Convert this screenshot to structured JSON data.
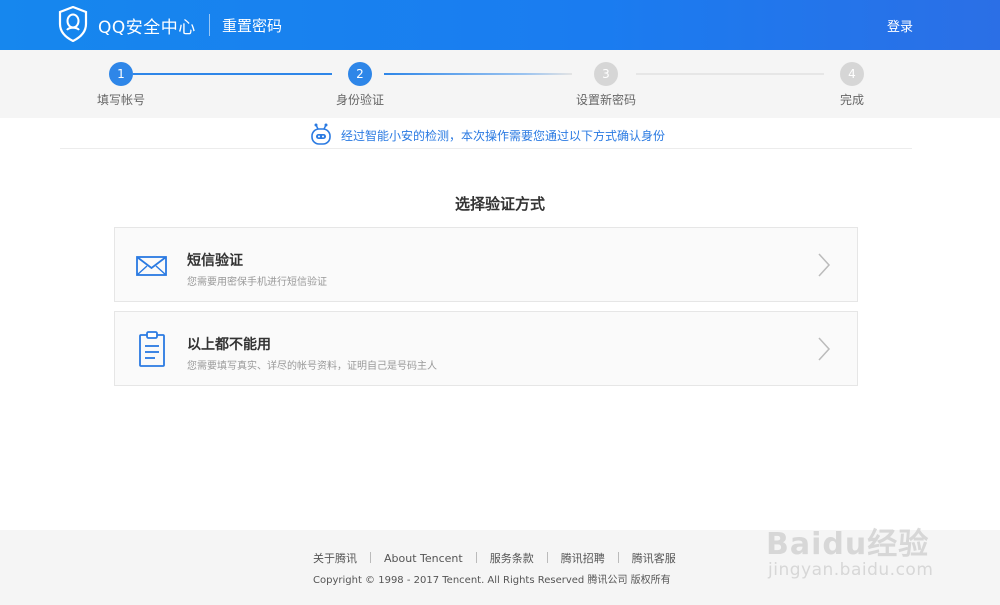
{
  "header": {
    "brand": "QQ安全中心",
    "page_name": "重置密码",
    "login": "登录",
    "colors": {
      "bar": "#1a7cf0",
      "text": "#ffffff"
    }
  },
  "steps": [
    {
      "number": "1",
      "label": "填写帐号",
      "state": "done"
    },
    {
      "number": "2",
      "label": "身份验证",
      "state": "current"
    },
    {
      "number": "3",
      "label": "设置新密码",
      "state": "todo"
    },
    {
      "number": "4",
      "label": "完成",
      "state": "todo"
    }
  ],
  "step_colors": {
    "active": "#2e86e8",
    "inactive": "#d6d6d6"
  },
  "notice": {
    "icon": "robot-icon",
    "text": "经过智能小安的检测，本次操作需要您通过以下方式确认身份"
  },
  "main": {
    "title": "选择验证方式",
    "options": [
      {
        "icon": "envelope-icon",
        "title": "短信验证",
        "desc": "您需要用密保手机进行短信验证"
      },
      {
        "icon": "clipboard-icon",
        "title": "以上都不能用",
        "desc": "您需要填写真实、详尽的帐号资料，证明自己是号码主人"
      }
    ]
  },
  "footer": {
    "links": [
      "关于腾讯",
      "About Tencent",
      "服务条款",
      "腾讯招聘",
      "腾讯客服"
    ],
    "copyright": "Copyright © 1998 - 2017 Tencent. All Rights Reserved 腾讯公司 版权所有"
  },
  "watermark": {
    "main": "Baidu经验",
    "sub": "jingyan.baidu.com"
  }
}
